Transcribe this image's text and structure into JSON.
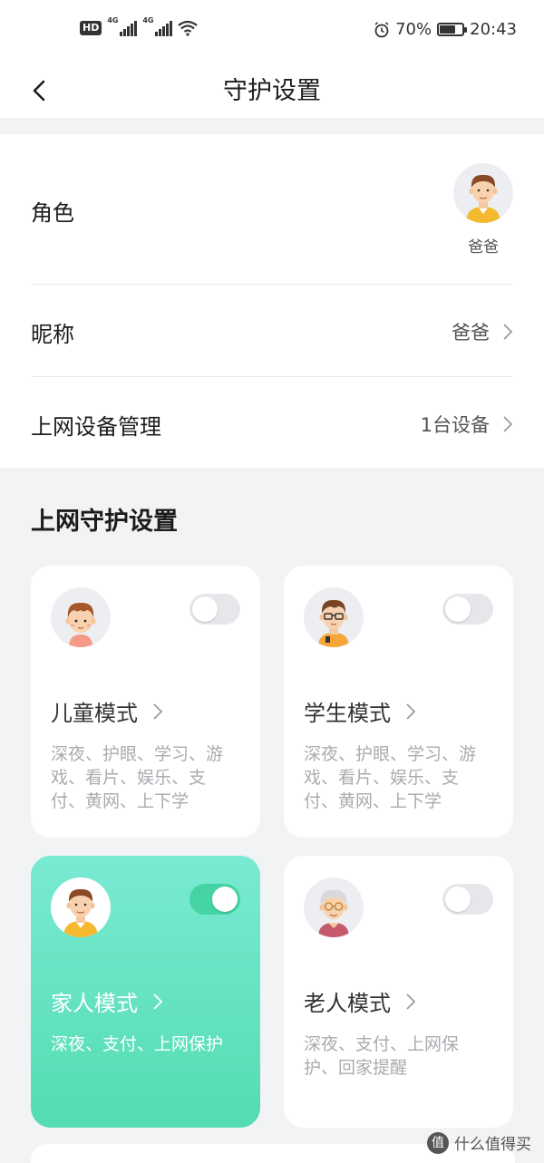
{
  "status_bar": {
    "network_1": "4G",
    "network_2": "4G",
    "battery_percent": "70%",
    "battery_level": 0.7,
    "time": "20:43",
    "hd_label": "HD"
  },
  "header": {
    "title": "守护设置"
  },
  "profile": {
    "role_label": "角色",
    "role_name": "爸爸",
    "nickname_label": "昵称",
    "nickname_value": "爸爸",
    "devices_label": "上网设备管理",
    "devices_value": "1台设备"
  },
  "section": {
    "title": "上网守护设置"
  },
  "modes": [
    {
      "title": "儿童模式",
      "desc": "深夜、护眼、学习、游戏、看片、娱乐、支付、黄网、上下学",
      "enabled": false
    },
    {
      "title": "学生模式",
      "desc": "深夜、护眼、学习、游戏、看片、娱乐、支付、黄网、上下学",
      "enabled": false
    },
    {
      "title": "家人模式",
      "desc": "深夜、支付、上网保护",
      "enabled": true
    },
    {
      "title": "老人模式",
      "desc": "深夜、支付、上网保护、回家提醒",
      "enabled": false
    }
  ],
  "watermark": {
    "text": "什么值得买",
    "logo": "值"
  },
  "colors": {
    "accent": "#45d3a3",
    "active_card_top": "#79ead3",
    "active_card_bottom": "#54dcb2"
  }
}
